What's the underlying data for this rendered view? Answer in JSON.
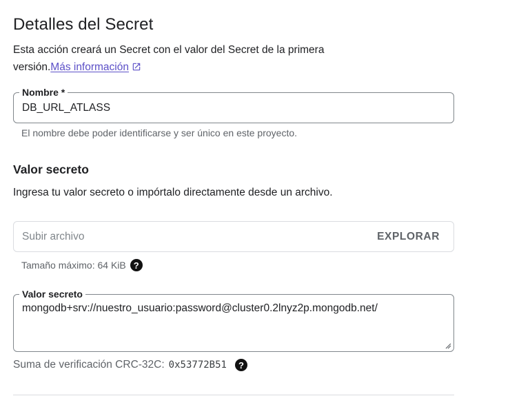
{
  "header": {
    "title": "Detalles del Secret"
  },
  "intro": {
    "text": "Esta acción creará un Secret con el valor del Secret de la primera versión.",
    "link_label": "Más información"
  },
  "name_field": {
    "label": "Nombre *",
    "value": "DB_URL_ATLASS",
    "hint": "El nombre debe poder identificarse y ser único en este proyecto."
  },
  "secret_section": {
    "title": "Valor secreto",
    "description": "Ingresa tu valor secreto o impórtalo directamente desde un archivo.",
    "upload": {
      "placeholder": "Subir archivo",
      "browse_label": "EXPLORAR",
      "size_hint": "Tamaño máximo: 64 KiB"
    },
    "value_field": {
      "label": "Valor secreto",
      "value": "mongodb+srv://nuestro_usuario:password@cluster0.2lnyz2p.mongodb.net/"
    },
    "checksum": {
      "label": "Suma de verificación CRC-32C:",
      "value": "0x53772B51"
    }
  },
  "icons": {
    "external_link": "external-link-icon",
    "help": "help-circle-icon",
    "resize": "resize-handle-icon"
  },
  "colors": {
    "link": "#5b4fc7",
    "text": "#202124",
    "muted": "#5f6368",
    "border": "#80868b"
  }
}
